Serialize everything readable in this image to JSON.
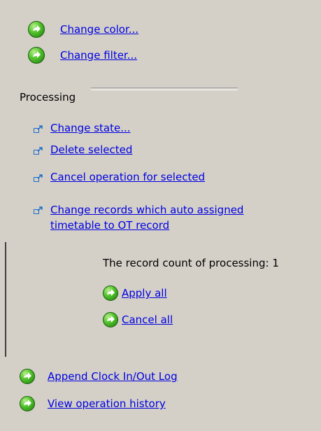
{
  "top_actions": [
    {
      "label": "Change color...",
      "icon": "green-go-icon"
    },
    {
      "label": "Change filter...",
      "icon": "green-go-icon"
    }
  ],
  "processing": {
    "title": "Processing",
    "items": [
      {
        "label": "Change state...",
        "icon": "link-arrow-icon"
      },
      {
        "label": "Delete selected",
        "icon": "link-arrow-icon"
      },
      {
        "label": "Cancel operation for selected",
        "icon": "link-arrow-icon"
      },
      {
        "label_line1": "Change records which auto assigned",
        "label_line2": "timetable to OT record",
        "icon": "link-arrow-icon"
      }
    ],
    "count_label": "The record count of processing: 1",
    "apply_all": "Apply all",
    "cancel_all": "Cancel all"
  },
  "bottom_actions": [
    {
      "label": "Append Clock In/Out Log",
      "icon": "green-go-icon"
    },
    {
      "label": "View operation history",
      "icon": "green-go-icon"
    }
  ],
  "colors": {
    "background": "#d4d0c8",
    "link": "#0000e0",
    "icon_green": "#4fc02a"
  }
}
